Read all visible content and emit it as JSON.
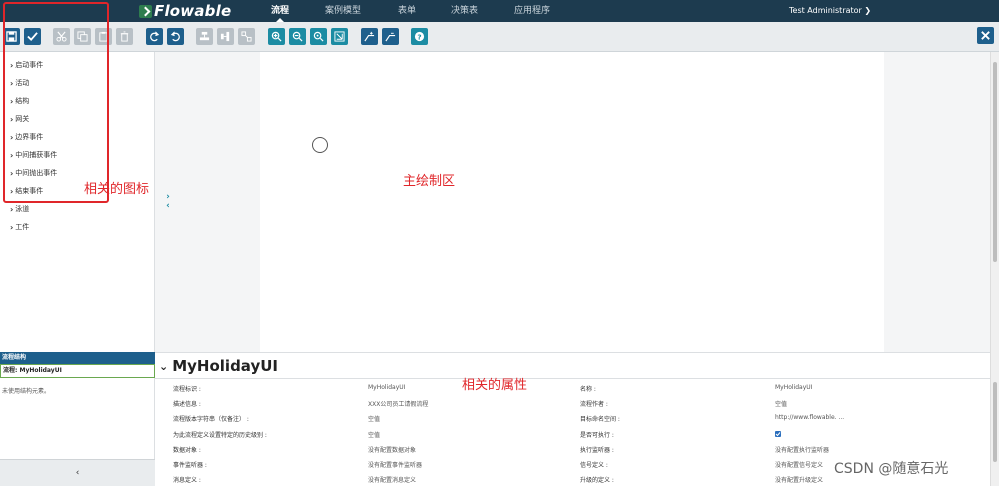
{
  "app": {
    "logo": "Flowable",
    "nav": [
      "流程",
      "案例模型",
      "表单",
      "决策表",
      "应用程序"
    ],
    "active_nav": "流程",
    "user": "Test Administrator ❯"
  },
  "colors": {
    "nav_bg": "#1d3b4f",
    "accent": "#1e5f8c",
    "annotation": "#e0262a"
  },
  "toolbar": {
    "icons": [
      "save-icon",
      "validate-icon",
      "cut-icon",
      "copy-icon",
      "paste-icon",
      "delete-icon",
      "redo-icon",
      "undo-icon",
      "align-vertical-icon",
      "align-horizontal-icon",
      "same-size-icon",
      "zoom-in-icon",
      "zoom-out-icon",
      "zoom-actual-icon",
      "zoom-fit-icon",
      "bend-add-icon",
      "bend-remove-icon",
      "help-icon"
    ],
    "close_icon": "close-icon"
  },
  "palette": {
    "items": [
      "启动事件",
      "活动",
      "结构",
      "网关",
      "边界事件",
      "中间捕获事件",
      "中间抛出事件",
      "结束事件",
      "泳道",
      "工件"
    ]
  },
  "annotations": {
    "icons": "相关的图标",
    "canvas": "主绘制区",
    "props": "相关的属性"
  },
  "structure": {
    "header": "流程结构",
    "selected": "流程: MyHolidayUI",
    "empty": "未使用结构元素。",
    "collapse": "‹"
  },
  "props": {
    "title": "MyHolidayUI",
    "left": [
      {
        "label": "流程标识 :",
        "value": "MyHolidayUI"
      },
      {
        "label": "描述信息 :",
        "value": "XXX公司员工请假流程"
      },
      {
        "label": "流程版本字符串（仅备注） :",
        "value": "空值"
      },
      {
        "label": "为此流程定义设置特定的历史级别 :",
        "value": "空值"
      },
      {
        "label": "数据对象 :",
        "value": "没有配置数据对象"
      },
      {
        "label": "事件监听器 :",
        "value": "没有配置事件监听器"
      },
      {
        "label": "消息定义 :",
        "value": "没有配置消息定义"
      }
    ],
    "right": [
      {
        "label": "名称 :",
        "value": "MyHolidayUI"
      },
      {
        "label": "流程作者 :",
        "value": "空值"
      },
      {
        "label": "目标命名空间 :",
        "value": "http://www.flowable. ..."
      },
      {
        "label": "是否可执行 :",
        "value": ""
      },
      {
        "label": "执行监听器 :",
        "value": "没有配置执行监听器"
      },
      {
        "label": "信号定义 :",
        "value": "没有配置信号定义"
      },
      {
        "label": "升级的定义 :",
        "value": "没有配置升级定义"
      }
    ]
  },
  "watermark": "CSDN @随意石光"
}
